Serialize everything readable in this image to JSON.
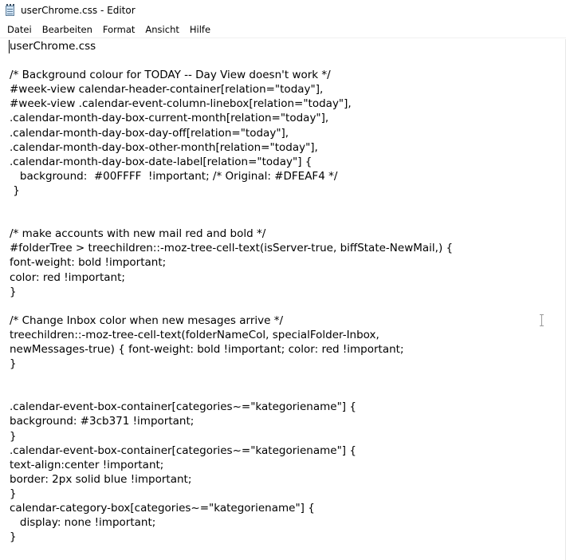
{
  "window": {
    "title": "userChrome.css - Editor",
    "icon": "notepad-icon"
  },
  "menubar": {
    "items": [
      {
        "label": "Datei"
      },
      {
        "label": "Bearbeiten"
      },
      {
        "label": "Format"
      },
      {
        "label": "Ansicht"
      },
      {
        "label": "Hilfe"
      }
    ]
  },
  "editor": {
    "content": "userChrome.css\n\n/* Background colour for TODAY -- Day View doesn't work */\n#week-view calendar-header-container[relation=\"today\"],\n#week-view .calendar-event-column-linebox[relation=\"today\"],\n.calendar-month-day-box-current-month[relation=\"today\"],\n.calendar-month-day-box-day-off[relation=\"today\"],\n.calendar-month-day-box-other-month[relation=\"today\"],\n.calendar-month-day-box-date-label[relation=\"today\"] {\n   background:  #00FFFF  !important; /* Original: #DFEAF4 */\n }\n\n\n/* make accounts with new mail red and bold */\n#folderTree > treechildren::-moz-tree-cell-text(isServer-true, biffState-NewMail,) {\nfont-weight: bold !important;\ncolor: red !important;\n}\n\n/* Change Inbox color when new mesages arrive */\ntreechildren::-moz-tree-cell-text(folderNameCol, specialFolder-Inbox,\nnewMessages-true) { font-weight: bold !important; color: red !important;\n}\n\n\n.calendar-event-box-container[categories~=\"kategoriename\"] {\nbackground: #3cb371 !important;\n}\n.calendar-event-box-container[categories~=\"kategoriename\"] {\ntext-align:center !important;\nborder: 2px solid blue !important;\n}\ncalendar-category-box[categories~=\"kategoriename\"] {\n   display: none !important;\n}"
  }
}
